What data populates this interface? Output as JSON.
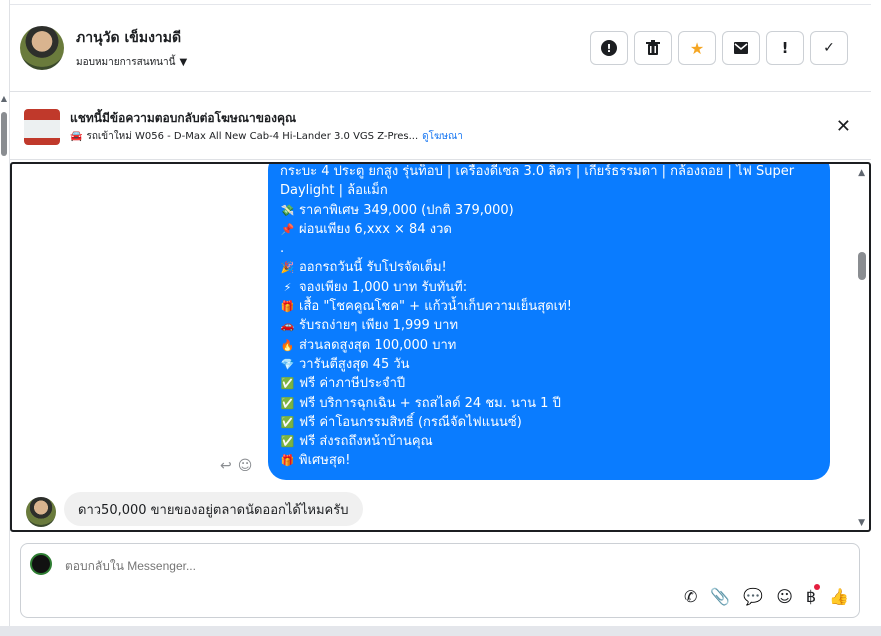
{
  "header": {
    "contact_name": "ภานุวัด เข็มงามดี",
    "assign_label": "มอบหมายการสนทนานี้",
    "actions": [
      {
        "name": "mark-spam",
        "icon": "alert-circle-icon",
        "label": "!"
      },
      {
        "name": "delete",
        "icon": "trash-icon",
        "label": "🗑"
      },
      {
        "name": "star",
        "icon": "star-icon",
        "label": "★"
      },
      {
        "name": "move-to-done",
        "icon": "mail-icon",
        "label": "✉"
      },
      {
        "name": "follow-up",
        "icon": "exclamation-icon",
        "label": "!"
      },
      {
        "name": "mark-done",
        "icon": "check-icon",
        "label": "✓"
      }
    ]
  },
  "ad": {
    "title": "แชทนี้มีข้อความตอบกลับต่อโฆษณาของคุณ",
    "car_icon": "🚘",
    "subtitle": "รถเข้าใหม่ W056 - D-Max All New Cab-4 Hi-Lander 3.0 VGS Z-Pres...",
    "link": "ดูโฆษณา",
    "close": "✕"
  },
  "conversation": {
    "outgoing_lines": [
      {
        "emoji": "",
        "text": "กระบะ 4 ประตู ยกสูง รุ่นท็อป | เครื่องดีเซล 3.0 ลิตร | เกียร์ธรรมดา | กล้องถอย | ไฟ Super"
      },
      {
        "emoji": "",
        "text": "Daylight | ล้อแม็ก"
      },
      {
        "emoji": "💸",
        "text": "ราคาพิเศษ 349,000 (ปกติ 379,000)"
      },
      {
        "emoji": "📌",
        "text": "ผ่อนเพียง 6,xxx × 84 งวด"
      },
      {
        "emoji": "",
        "text": "."
      },
      {
        "emoji": "🎉",
        "text": "ออกรถวันนี้ รับโปรจัดเต็ม!"
      },
      {
        "emoji": "⚡",
        "text": "จองเพียง 1,000 บาท รับทันที:"
      },
      {
        "emoji": "🎁",
        "text": "เสื้อ \"โชคคูณโชค\" + แก้วน้ำเก็บความเย็นสุดเท่!"
      },
      {
        "emoji": "🚗",
        "text": "รับรถง่ายๆ เพียง 1,999 บาท"
      },
      {
        "emoji": "🔥",
        "text": "ส่วนลดสูงสุด 100,000 บาท"
      },
      {
        "emoji": "💎",
        "text": "วารันตีสูงสุด 45 วัน"
      },
      {
        "emoji": "✅",
        "text": "ฟรี ค่าภาษีประจำปี"
      },
      {
        "emoji": "✅",
        "text": "ฟรี บริการฉุกเฉิน + รถสไลด์ 24 ชม. นาน 1 ปี"
      },
      {
        "emoji": "✅",
        "text": "ฟรี ค่าโอนกรรมสิทธิ์ (กรณีจัดไฟแนนซ์)"
      },
      {
        "emoji": "✅",
        "text": "ฟรี ส่งรถถึงหน้าบ้านคุณ"
      },
      {
        "emoji": "🎁",
        "text": "พิเศษสุด!"
      }
    ],
    "incoming_message": "ดาว50,000 ขายของอยู่ตลาดนัดออกได้ไหมครับ"
  },
  "reply": {
    "placeholder": "ตอบกลับใน Messenger..."
  },
  "colors": {
    "outgoing_bubble": "#0a7cff",
    "incoming_bubble": "#f0f0f0",
    "link": "#1877f2",
    "star": "#f5a623"
  }
}
